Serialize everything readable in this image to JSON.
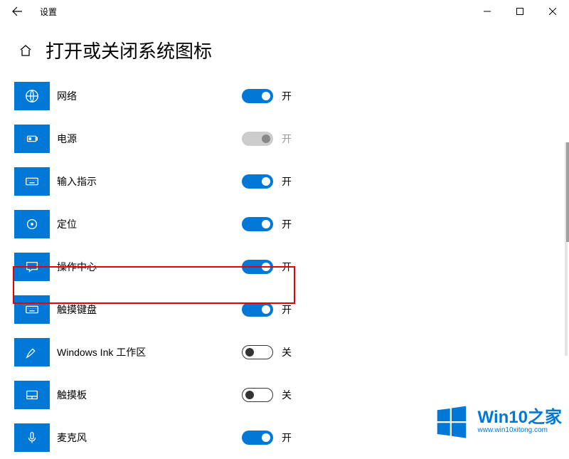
{
  "app": {
    "title": "设置"
  },
  "page": {
    "title": "打开或关闭系统图标"
  },
  "state_labels": {
    "on": "开",
    "off": "关"
  },
  "items": [
    {
      "id": "network",
      "label": "网络",
      "state": "on"
    },
    {
      "id": "power",
      "label": "电源",
      "state": "on-disabled"
    },
    {
      "id": "input-indicator",
      "label": "输入指示",
      "state": "on"
    },
    {
      "id": "location",
      "label": "定位",
      "state": "on"
    },
    {
      "id": "action-center",
      "label": "操作中心",
      "state": "on"
    },
    {
      "id": "touch-keyboard",
      "label": "触摸键盘",
      "state": "on",
      "highlighted": true
    },
    {
      "id": "windows-ink",
      "label": "Windows Ink 工作区",
      "state": "off"
    },
    {
      "id": "touchpad",
      "label": "触摸板",
      "state": "off"
    },
    {
      "id": "microphone",
      "label": "麦克风",
      "state": "on"
    }
  ],
  "watermark": {
    "line1": "Win10之家",
    "line2": "www.win10xitong.com"
  },
  "colors": {
    "accent": "#0078d7",
    "highlight": "#e60000"
  }
}
